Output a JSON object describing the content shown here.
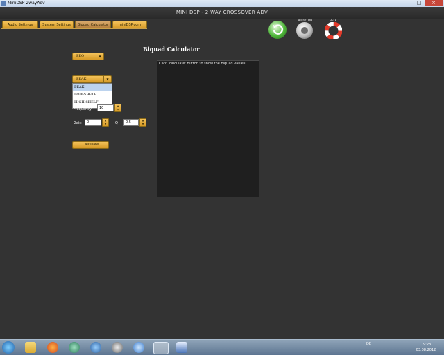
{
  "window": {
    "title": "MiniDSP-2wayAdv"
  },
  "app": {
    "title": "MINI DSP - 2 WAY CROSSOVER ADV"
  },
  "tabs": [
    {
      "label": "Audio Settings"
    },
    {
      "label": "System Settings"
    },
    {
      "label": "Biquad Calculator"
    },
    {
      "label": "miniDSP.com"
    }
  ],
  "toolbar": {
    "audio_label": "AUDIO ON",
    "help_label": "HELP"
  },
  "calculator": {
    "heading": "Biquad Calculator",
    "type_select": "PEQ",
    "filter_select": "PEAK",
    "filter_options": [
      "PEAK",
      "LOW-SHELF",
      "HIGH-SHELF"
    ],
    "frequency_label": "Frequency",
    "frequency_value": "10",
    "gain_label": "Gain",
    "gain_value": "0",
    "q_label": "Q",
    "q_value": "0.5",
    "calculate_label": "Calculate",
    "output_text": "Click 'calculate' button to show the biquad values."
  },
  "taskbar": {
    "language": "DE",
    "time": "19:23",
    "date": "03.08.2012"
  }
}
